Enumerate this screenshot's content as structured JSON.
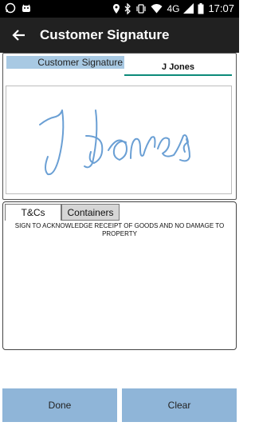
{
  "status_bar": {
    "time": "17:07",
    "network": "4G",
    "left_icons": [
      "whatsapp-icon",
      "android-icon"
    ],
    "right_icons": [
      "location-icon",
      "bluetooth-icon",
      "vibrate-icon",
      "wifi-icon",
      "signal-icon",
      "battery-icon"
    ]
  },
  "toolbar": {
    "back_icon": "arrow-left-icon",
    "title": "Customer Signature"
  },
  "signature": {
    "label": "Customer Signature",
    "name_value": "J Jones",
    "stroke_color": "#6a9fd4"
  },
  "terms": {
    "tabs": [
      {
        "label": "T&Cs",
        "selected": true
      },
      {
        "label": "Containers",
        "selected": false
      }
    ],
    "text": "SIGN TO ACKNOWLEDGE RECEIPT OF GOODS AND NO DAMAGE TO PROPERTY"
  },
  "buttons": {
    "done": "Done",
    "clear": "Clear"
  },
  "colors": {
    "toolbar_bg": "#212121",
    "accent": "#0c8a7a",
    "button_bg": "#8fb5d8",
    "label_bg": "#a8c9e3"
  }
}
